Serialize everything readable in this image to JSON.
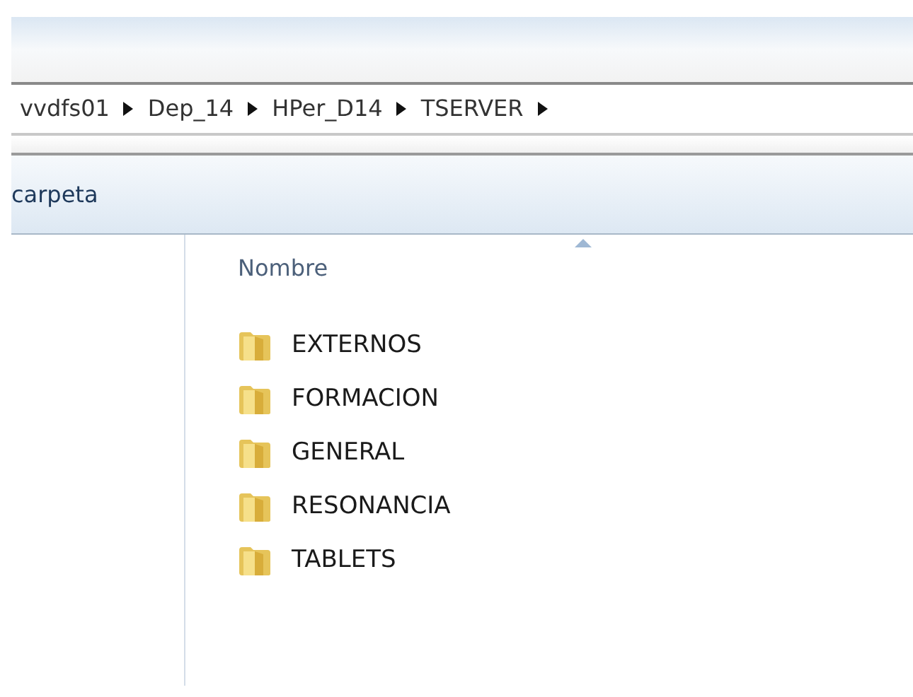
{
  "breadcrumb": [
    {
      "label": "vvdfs01"
    },
    {
      "label": "Dep_14"
    },
    {
      "label": "HPer_D14"
    },
    {
      "label": "TSERVER"
    }
  ],
  "toolbar": {
    "label": "carpeta"
  },
  "file_list": {
    "column": "Nombre",
    "items": [
      {
        "name": "EXTERNOS"
      },
      {
        "name": "FORMACION"
      },
      {
        "name": "GENERAL"
      },
      {
        "name": "RESONANCIA"
      },
      {
        "name": "TABLETS"
      }
    ]
  }
}
